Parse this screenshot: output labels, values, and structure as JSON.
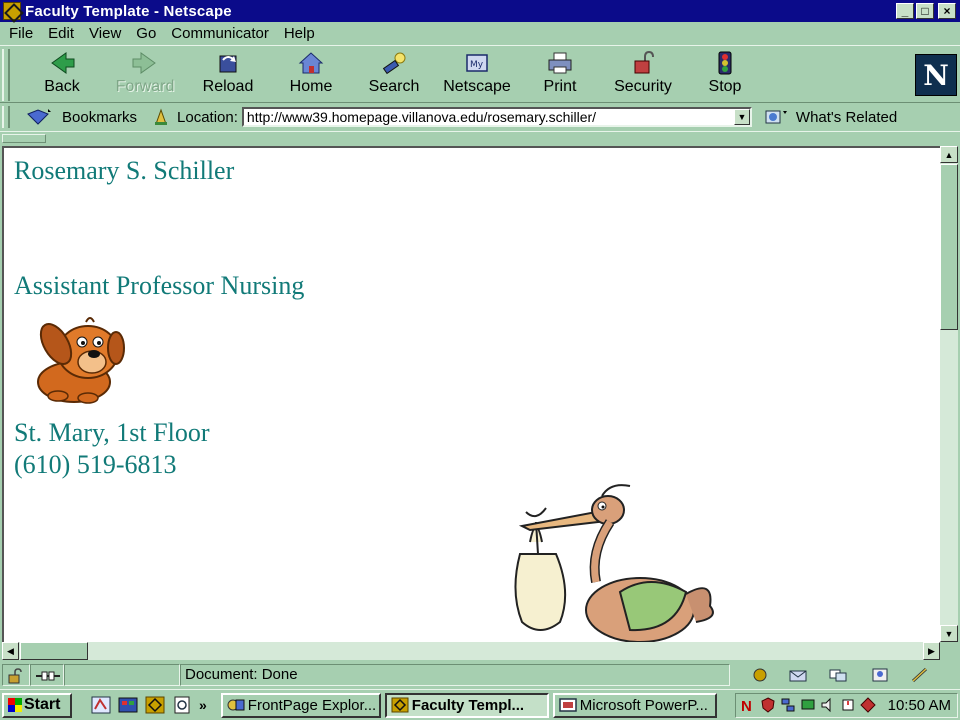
{
  "window": {
    "title": "Faculty Template - Netscape",
    "buttons": [
      "_",
      "□",
      "×"
    ]
  },
  "menu": [
    "File",
    "Edit",
    "View",
    "Go",
    "Communicator",
    "Help"
  ],
  "toolbar": {
    "back": "Back",
    "forward": "Forward",
    "reload": "Reload",
    "home": "Home",
    "search": "Search",
    "netscape": "Netscape",
    "print": "Print",
    "security": "Security",
    "stop": "Stop",
    "logo": "N"
  },
  "location_bar": {
    "bookmarks": "Bookmarks",
    "location_label": "Location:",
    "url": "http://www39.homepage.villanova.edu/rosemary.schiller/",
    "whats_related": "What's Related"
  },
  "page": {
    "name": "Rosemary S. Schiller",
    "position": "Assistant Professor Nursing",
    "office": "St. Mary, 1st Floor",
    "phone": "(610) 519-6813",
    "text_color": "#117a78"
  },
  "status": {
    "text": "Document: Done"
  },
  "taskbar": {
    "start": "Start",
    "more": "»",
    "tasks": [
      {
        "label": "FrontPage Explor...",
        "active": false
      },
      {
        "label": "Faculty Templ...",
        "active": true
      },
      {
        "label": "Microsoft PowerP...",
        "active": false
      }
    ],
    "clock": "10:50 AM"
  },
  "icons": {
    "dog": "cartoon-dog-icon",
    "stork": "cartoon-stork-icon"
  }
}
